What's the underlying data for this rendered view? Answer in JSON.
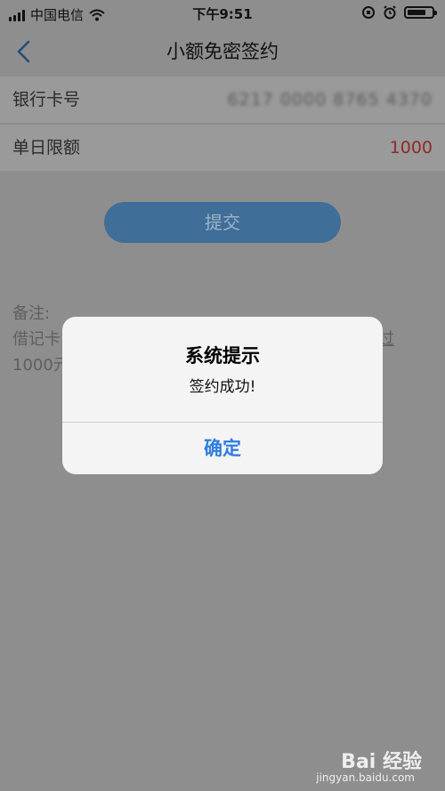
{
  "status_bar": {
    "carrier": "中国电信",
    "time": "下午9:51",
    "battery_level": 0.75
  },
  "nav": {
    "title": "小额免密签约"
  },
  "form": {
    "card_label": "银行卡号",
    "card_value": "6217 0000 8765 4370",
    "limit_label": "单日限额",
    "limit_value": "1000"
  },
  "submit_label": "提交",
  "notes": {
    "heading": "备注:",
    "line1": "借记卡",
    "line1_tail": "过",
    "line2": "1000元"
  },
  "dialog": {
    "title": "系统提示",
    "message": "签约成功!",
    "confirm": "确定"
  },
  "watermark": {
    "text": "Bai 经验",
    "url": "jingyan.baidu.com"
  },
  "colors": {
    "accent": "#2f7de0",
    "limit": "#8f2a2a"
  }
}
